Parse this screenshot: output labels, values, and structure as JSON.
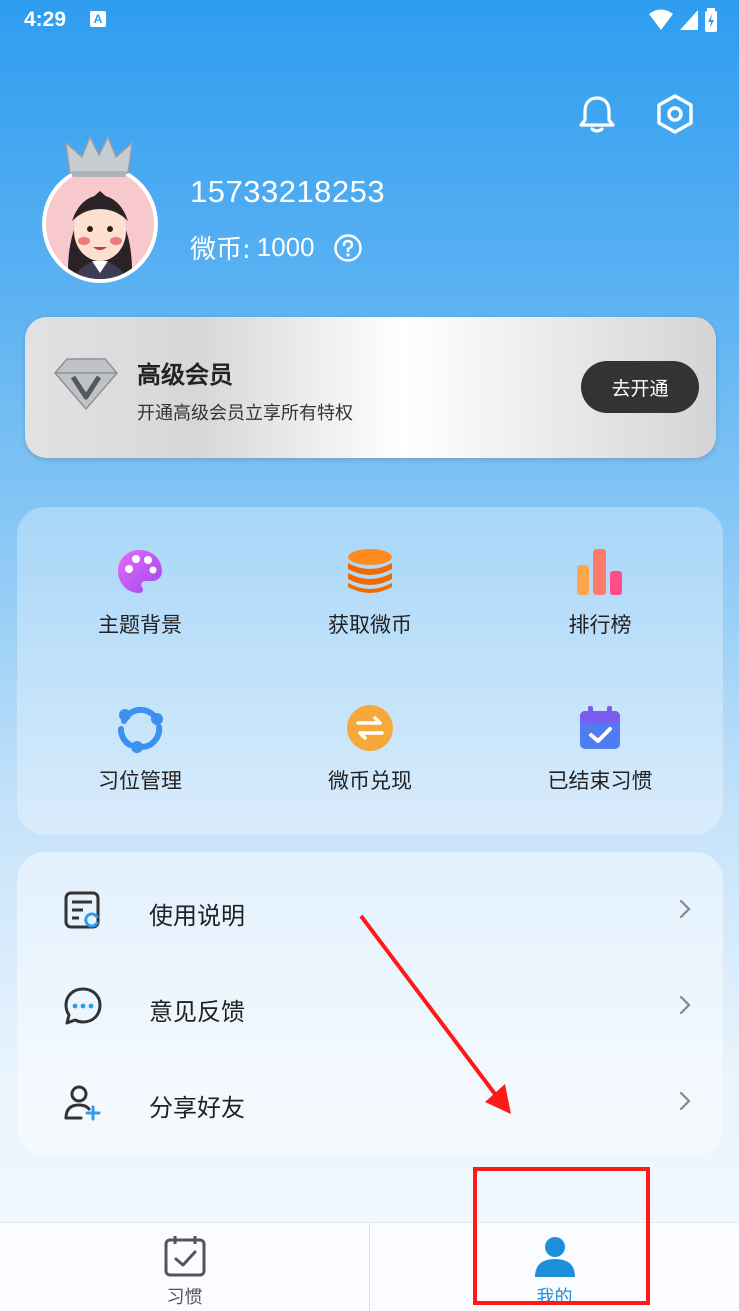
{
  "status_bar": {
    "time": "4:29",
    "notification_icon": "A"
  },
  "header": {
    "bell_icon": "bell-icon",
    "settings_icon": "settings-icon"
  },
  "profile": {
    "phone": "15733218253",
    "coins_label": "微币:",
    "coins_value": "1000"
  },
  "vip": {
    "title": "高级会员",
    "subtitle": "开通高级会员立享所有特权",
    "button": "去开通"
  },
  "grid": [
    {
      "label": "主题背景",
      "icon": "palette-icon"
    },
    {
      "label": "获取微币",
      "icon": "coins-stack-icon"
    },
    {
      "label": "排行榜",
      "icon": "bar-chart-icon"
    },
    {
      "label": "习位管理",
      "icon": "cycle-icon"
    },
    {
      "label": "微币兑现",
      "icon": "exchange-icon"
    },
    {
      "label": "已结束习惯",
      "icon": "calendar-check-icon"
    }
  ],
  "list": [
    {
      "label": "使用说明",
      "icon": "document-icon"
    },
    {
      "label": "意见反馈",
      "icon": "chat-icon"
    },
    {
      "label": "分享好友",
      "icon": "add-user-icon"
    }
  ],
  "bottom_nav": [
    {
      "label": "习惯",
      "icon": "calendar-check-icon",
      "active": false
    },
    {
      "label": "我的",
      "icon": "person-icon",
      "active": true
    }
  ],
  "colors": {
    "accent": "#1e8fdc",
    "annotation": "#ff1a1a"
  }
}
